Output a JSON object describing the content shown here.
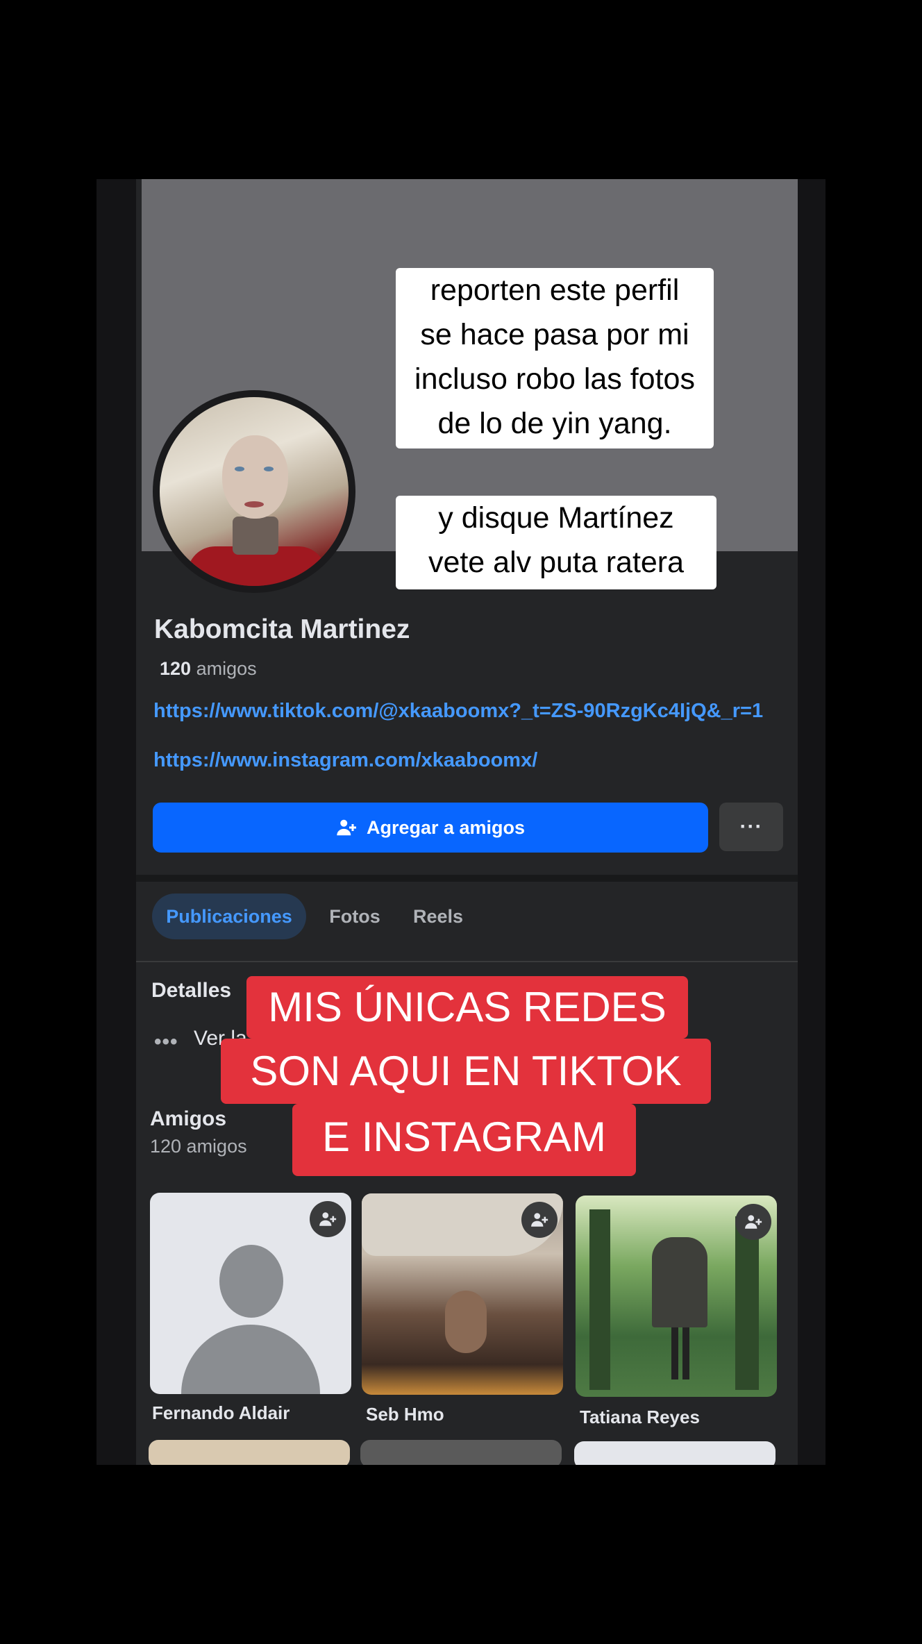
{
  "profile": {
    "name": "Kabomcita Martinez",
    "friends_number": "120",
    "friends_label": "amigos",
    "links": [
      "https://www.tiktok.com/@xkaaboomx?_t=ZS-90RzgKc4IjQ&_r=1",
      "https://www.instagram.com/xkaaboomx/"
    ]
  },
  "actions": {
    "add_friend_label": "Agregar a amigos",
    "more_label": "···"
  },
  "tabs": [
    "Publicaciones",
    "Fotos",
    "Reels"
  ],
  "details": {
    "title": "Detalles",
    "see_more": "Ver la"
  },
  "friends": {
    "title": "Amigos",
    "count_label": "120 amigos",
    "cards": [
      {
        "name": "Fernando Aldair"
      },
      {
        "name": "Seb Hmo"
      },
      {
        "name": "Tatiana Reyes"
      }
    ]
  },
  "overlay_captions": {
    "top": [
      "reporten este perfil",
      "se hace pasa por mi",
      "incluso robo las fotos",
      "de lo de yin yang."
    ],
    "middle": [
      "y disque Martínez",
      "vete alv puta ratera"
    ],
    "red": [
      "MIS ÚNICAS REDES",
      "SON AQUI EN TIKTOK",
      "E INSTAGRAM"
    ]
  },
  "colors": {
    "accent": "#0866ff",
    "link": "#4599ff",
    "red_caption": "#e3323c"
  }
}
